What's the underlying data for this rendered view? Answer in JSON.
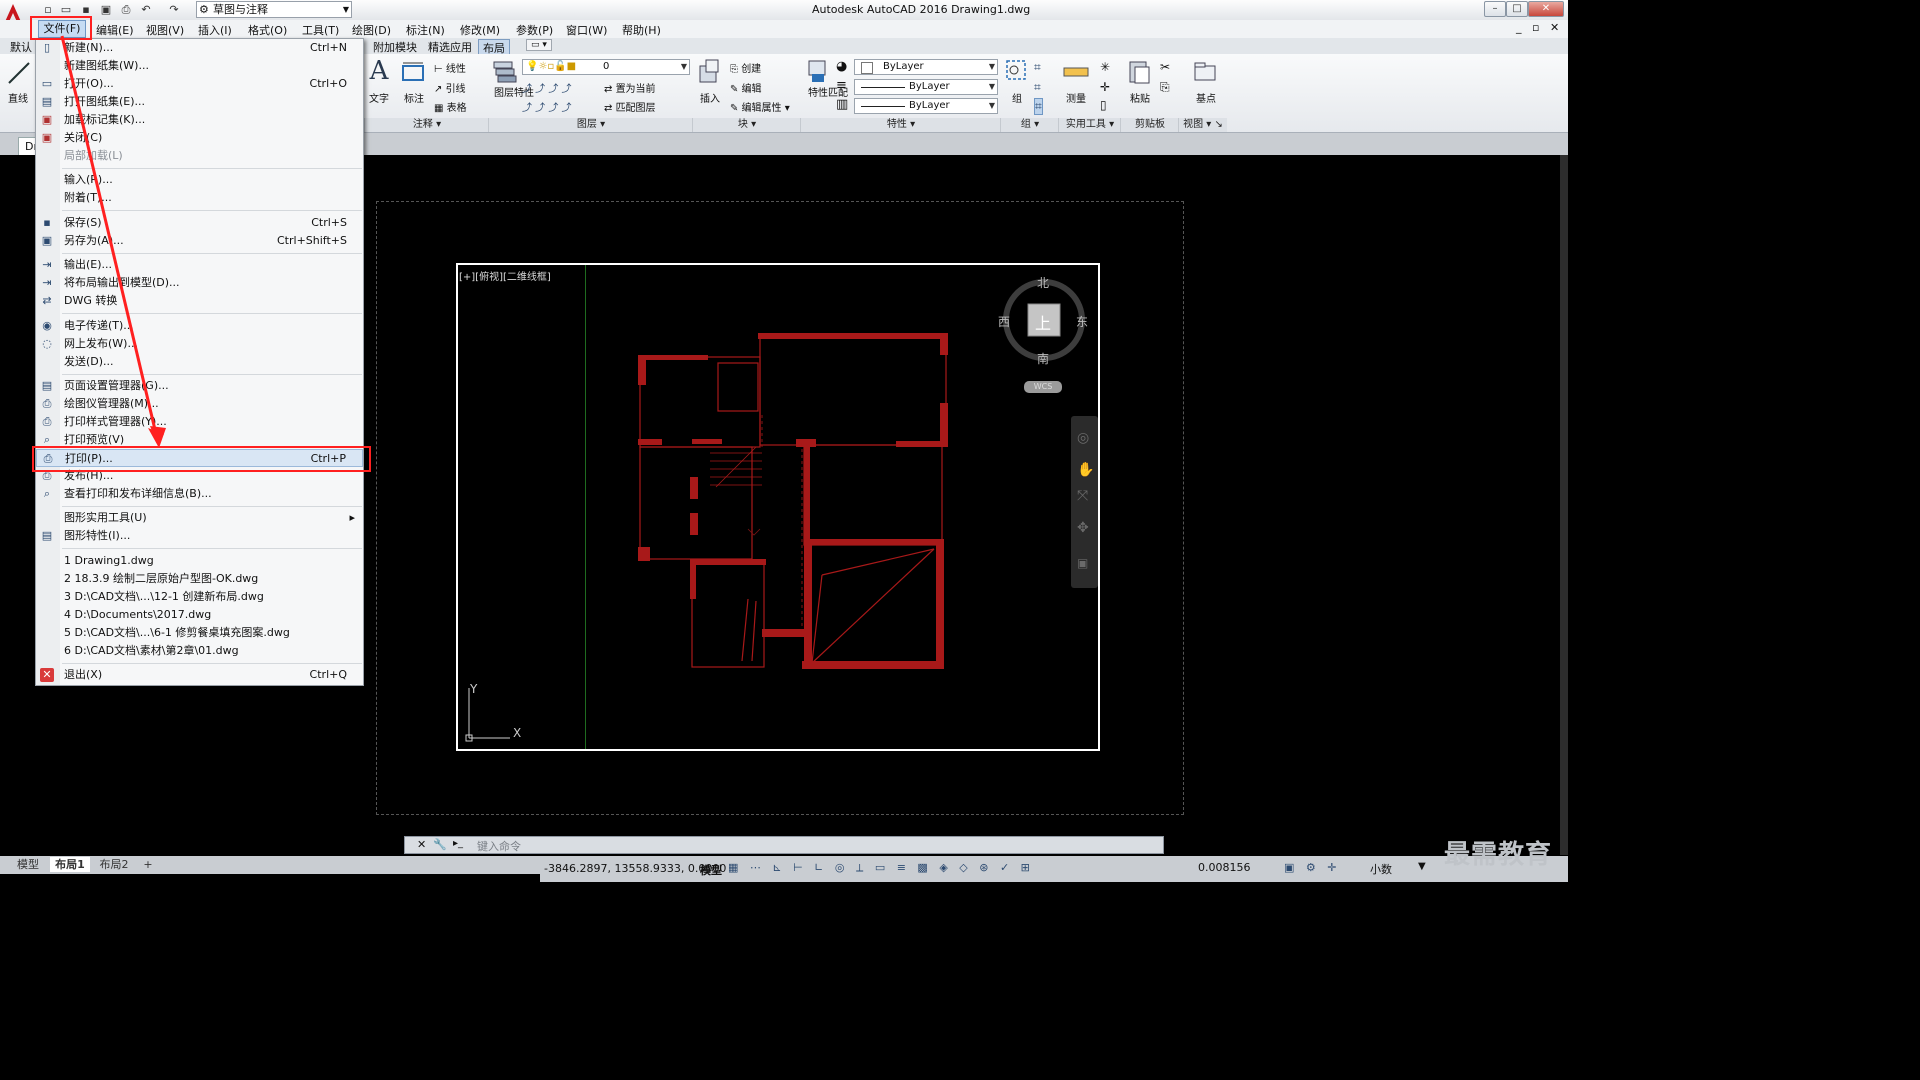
{
  "title_bar": {
    "workspace": "草图与注释",
    "app_title": "Autodesk AutoCAD 2016    Drawing1.dwg"
  },
  "menubar": {
    "items": [
      "文件(F)",
      "编辑(E)",
      "视图(V)",
      "插入(I)",
      "格式(O)",
      "工具(T)",
      "绘图(D)",
      "标注(N)",
      "修改(M)",
      "参数(P)",
      "窗口(W)",
      "帮助(H)"
    ]
  },
  "ribbon": {
    "tabs": [
      "默认",
      "附加模块",
      "精选应用",
      "布局"
    ],
    "draw_panel": {
      "line": "直线"
    },
    "annotation": {
      "text": "文字",
      "dim": "标注",
      "linear": "线性",
      "leader": "引线",
      "table": "表格",
      "title": "注释"
    },
    "layers": {
      "props": "图层特性",
      "current_layer": "0",
      "set_current": "置为当前",
      "match": "匹配图层",
      "title": "图层"
    },
    "block": {
      "insert": "插入",
      "create": "创建",
      "edit": "编辑",
      "edit_attr": "编辑属性",
      "title": "块"
    },
    "properties": {
      "match": "特性匹配",
      "color": "ByLayer",
      "linetype": "ByLayer",
      "lineweight": "ByLayer",
      "title": "特性"
    },
    "group": {
      "group": "组",
      "title": "组"
    },
    "utilities": {
      "measure": "测量",
      "title": "实用工具"
    },
    "clipboard": {
      "paste": "粘贴",
      "title": "剪贴板"
    },
    "view": {
      "base": "基点",
      "title": "视图"
    }
  },
  "doc_tab": "Dr",
  "viewport": {
    "label": "[+][俯视][二维线框]",
    "viewcube": {
      "north": "北",
      "south": "南",
      "east": "东",
      "west": "西",
      "face": "上",
      "wcs": "WCS"
    },
    "ucs": {
      "x": "X",
      "y": "Y"
    }
  },
  "command_line": {
    "placeholder": "键入命令"
  },
  "layout_tabs": [
    "模型",
    "布局1",
    "布局2",
    "+"
  ],
  "status_bar": {
    "coords": "-3846.2897, 13558.9333, 0.0000",
    "space": "模型",
    "scale": "0.008156",
    "units": "小数"
  },
  "file_menu": {
    "items": [
      {
        "label": "新建(N)...",
        "shortcut": "Ctrl+N",
        "icon": "new-icon"
      },
      {
        "label": "新建图纸集(W)...",
        "shortcut": "",
        "icon": ""
      },
      {
        "label": "打开(O)...",
        "shortcut": "Ctrl+O",
        "icon": "open-icon"
      },
      {
        "label": "打开图纸集(E)...",
        "shortcut": "",
        "icon": "open-sheet-icon"
      },
      {
        "label": "加载标记集(K)...",
        "shortcut": "",
        "icon": "markup-icon"
      },
      {
        "label": "关闭(C)",
        "shortcut": "",
        "icon": "close-icon"
      },
      {
        "label": "局部加载(L)",
        "shortcut": "",
        "icon": ""
      },
      {
        "label": "输入(R)...",
        "shortcut": "",
        "icon": ""
      },
      {
        "label": "附着(T)...",
        "shortcut": "",
        "icon": ""
      },
      {
        "label": "保存(S)",
        "shortcut": "Ctrl+S",
        "icon": "save-icon"
      },
      {
        "label": "另存为(A)...",
        "shortcut": "Ctrl+Shift+S",
        "icon": "save-as-icon"
      },
      {
        "label": "输出(E)...",
        "shortcut": "",
        "icon": "export-icon"
      },
      {
        "label": "将布局输出到模型(D)...",
        "shortcut": "",
        "icon": "export-layout-icon"
      },
      {
        "label": "DWG 转换",
        "shortcut": "",
        "icon": "dwg-convert-icon"
      },
      {
        "label": "电子传递(T)...",
        "shortcut": "",
        "icon": "etransmit-icon"
      },
      {
        "label": "网上发布(W)...",
        "shortcut": "",
        "icon": "web-publish-icon"
      },
      {
        "label": "发送(D)...",
        "shortcut": "",
        "icon": ""
      },
      {
        "label": "页面设置管理器(G)...",
        "shortcut": "",
        "icon": "page-setup-icon"
      },
      {
        "label": "绘图仪管理器(M)...",
        "shortcut": "",
        "icon": "plotter-icon"
      },
      {
        "label": "打印样式管理器(Y)...",
        "shortcut": "",
        "icon": "plot-style-icon"
      },
      {
        "label": "打印预览(V)",
        "shortcut": "",
        "icon": "preview-icon"
      },
      {
        "label": "打印(P)...",
        "shortcut": "Ctrl+P",
        "icon": "print-icon"
      },
      {
        "label": "发布(H)...",
        "shortcut": "",
        "icon": "publish-icon"
      },
      {
        "label": "查看打印和发布详细信息(B)...",
        "shortcut": "",
        "icon": "plot-details-icon"
      },
      {
        "label": "图形实用工具(U)",
        "shortcut": "",
        "icon": ""
      },
      {
        "label": "图形特性(I)...",
        "shortcut": "",
        "icon": "drawing-props-icon"
      },
      {
        "label": "1 Drawing1.dwg",
        "shortcut": "",
        "icon": ""
      },
      {
        "label": "2 18.3.9 绘制二层原始户型图-OK.dwg",
        "shortcut": "",
        "icon": ""
      },
      {
        "label": "3 D:\\CAD文档\\...\\12-1 创建新布局.dwg",
        "shortcut": "",
        "icon": ""
      },
      {
        "label": "4 D:\\Documents\\2017.dwg",
        "shortcut": "",
        "icon": ""
      },
      {
        "label": "5 D:\\CAD文档\\...\\6-1 修剪餐桌填充图案.dwg",
        "shortcut": "",
        "icon": ""
      },
      {
        "label": "6 D:\\CAD文档\\素材\\第2章\\01.dwg",
        "shortcut": "",
        "icon": ""
      },
      {
        "label": "退出(X)",
        "shortcut": "Ctrl+Q",
        "icon": "exit-icon"
      }
    ]
  },
  "watermark": "最需教育"
}
